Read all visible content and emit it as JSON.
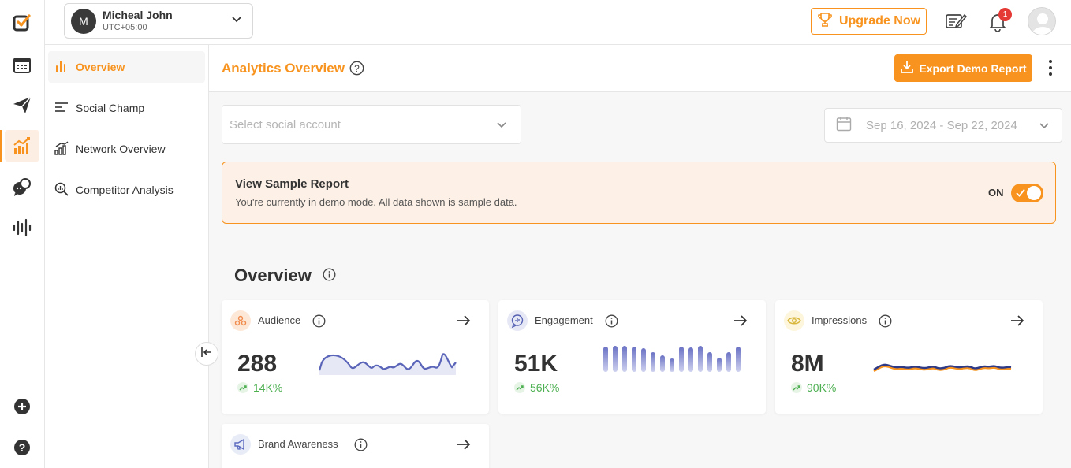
{
  "header": {
    "user_name": "Micheal John",
    "user_initial": "M",
    "timezone": "UTC+05:00",
    "upgrade_label": "Upgrade Now",
    "notification_count": "1"
  },
  "rail": {
    "icons": [
      "logo-check-icon",
      "calendar-icon",
      "publish-send-icon",
      "analytics-icon",
      "engage-chat-icon",
      "listening-wave-icon",
      "add-icon",
      "help-icon"
    ],
    "active": "analytics-icon"
  },
  "sidebar": {
    "items": [
      {
        "label": "Overview",
        "icon": "bar-chart-icon",
        "active": true
      },
      {
        "label": "Social Champ",
        "icon": "lines-icon",
        "active": false
      },
      {
        "label": "Network Overview",
        "icon": "network-bars-icon",
        "active": false
      },
      {
        "label": "Competitor Analysis",
        "icon": "competitor-search-icon",
        "active": false
      }
    ]
  },
  "main": {
    "title": "Analytics Overview",
    "export_label": "Export Demo Report",
    "select_placeholder": "Select social account",
    "date_range": "Sep 16, 2024 - Sep 22, 2024"
  },
  "banner": {
    "title": "View Sample Report",
    "text": "You're currently in demo mode. All data shown is sample data.",
    "toggle_label": "ON",
    "toggle_on": true
  },
  "overview": {
    "title": "Overview",
    "cards": [
      {
        "label": "Audience",
        "value": "288",
        "change": "14K%",
        "icon": "audience-icon",
        "icon_bg": "#fde8d8",
        "icon_color": "#f08a4b"
      },
      {
        "label": "Engagement",
        "value": "51K",
        "change": "56K%",
        "icon": "engagement-chat-icon",
        "icon_bg": "#e6e8f6",
        "icon_color": "#5561b3"
      },
      {
        "label": "Impressions",
        "value": "8M",
        "change": "90K%",
        "icon": "eye-icon",
        "icon_bg": "#fdf6dc",
        "icon_color": "#d8b63a"
      },
      {
        "label": "Brand Awareness",
        "value": "",
        "change": "",
        "icon": "megaphone-icon",
        "icon_bg": "#e8ecf7",
        "icon_color": "#5c6bc0"
      }
    ]
  },
  "colors": {
    "accent": "#f7931e",
    "positive": "#4caf50",
    "chart_blue": "#5a64b8",
    "chart_orange": "#f7931e"
  }
}
